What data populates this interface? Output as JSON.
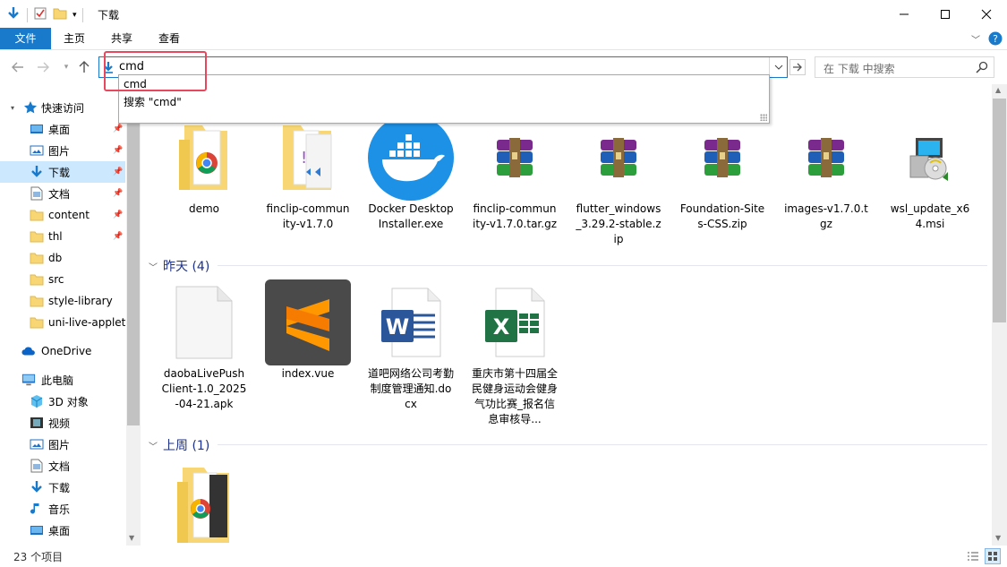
{
  "window": {
    "title": "下载",
    "controls": {
      "minimize": "—",
      "maximize": "☐",
      "close": "✕"
    }
  },
  "ribbon": {
    "tabs": [
      {
        "label": "文件"
      },
      {
        "label": "主页"
      },
      {
        "label": "共享"
      },
      {
        "label": "查看"
      }
    ]
  },
  "address": {
    "value": "cmd",
    "search_placeholder": "在 下载 中搜索"
  },
  "suggestions": [
    {
      "label": "cmd"
    },
    {
      "label": "搜索 \"cmd\""
    }
  ],
  "sidebar": {
    "items": [
      {
        "label": "快速访问",
        "icon": "star-icon"
      },
      {
        "label": "桌面",
        "icon": "desktop-icon",
        "pinned": true
      },
      {
        "label": "图片",
        "icon": "pictures-icon",
        "pinned": true
      },
      {
        "label": "下载",
        "icon": "download-icon",
        "pinned": true,
        "selected": true
      },
      {
        "label": "文档",
        "icon": "documents-icon",
        "pinned": true
      },
      {
        "label": "content",
        "icon": "folder-icon",
        "pinned": true
      },
      {
        "label": "thl",
        "icon": "folder-icon",
        "pinned": true
      },
      {
        "label": "db",
        "icon": "folder-icon"
      },
      {
        "label": "src",
        "icon": "folder-icon"
      },
      {
        "label": "style-library",
        "icon": "folder-icon"
      },
      {
        "label": "uni-live-applet",
        "icon": "folder-icon"
      },
      {
        "label": "OneDrive",
        "icon": "cloud-icon"
      },
      {
        "label": "此电脑",
        "icon": "computer-icon"
      },
      {
        "label": "3D 对象",
        "icon": "3d-objects-icon"
      },
      {
        "label": "视频",
        "icon": "videos-icon"
      },
      {
        "label": "图片",
        "icon": "pictures-icon"
      },
      {
        "label": "文档",
        "icon": "documents-icon"
      },
      {
        "label": "下载",
        "icon": "download-icon"
      },
      {
        "label": "音乐",
        "icon": "music-icon"
      },
      {
        "label": "桌面",
        "icon": "desktop-icon"
      }
    ]
  },
  "groups": [
    {
      "header": "",
      "files": [
        {
          "name": "demo",
          "icon": "chrome-folder-icon"
        },
        {
          "name": "finclip-community-v1.7.0",
          "icon": "folder-vscode-icon"
        },
        {
          "name": "Docker Desktop Installer.exe",
          "icon": "docker-icon"
        },
        {
          "name": "finclip-community-v1.7.0.tar.gz",
          "icon": "winrar-icon"
        },
        {
          "name": "flutter_windows_3.29.2-stable.zip",
          "icon": "winrar-icon"
        },
        {
          "name": "Foundation-Sites-CSS.zip",
          "icon": "winrar-icon"
        },
        {
          "name": "images-v1.7.0.tgz",
          "icon": "winrar-icon"
        },
        {
          "name": "wsl_update_x64.msi",
          "icon": "msi-installer-icon"
        }
      ]
    },
    {
      "header": "昨天 (4)",
      "files": [
        {
          "name": "daobaLivePushClient-1.0_2025-04-21.apk",
          "icon": "blank-file-icon"
        },
        {
          "name": "index.vue",
          "icon": "sublime-icon"
        },
        {
          "name": "道吧网络公司考勤制度管理通知.docx",
          "icon": "word-icon"
        },
        {
          "name": "重庆市第十四届全民健身运动会健身气功比赛_报名信息审核导...",
          "icon": "excel-icon"
        }
      ]
    },
    {
      "header": "上周 (1)",
      "files": [
        {
          "name": "",
          "icon": "chrome-folder-icon"
        }
      ]
    }
  ],
  "status": {
    "item_count": "23 个项目"
  },
  "colors": {
    "accent": "#1979ca",
    "selection": "#cce8ff",
    "highlight_box": "#e8475d",
    "group_header": "#1e3287"
  }
}
